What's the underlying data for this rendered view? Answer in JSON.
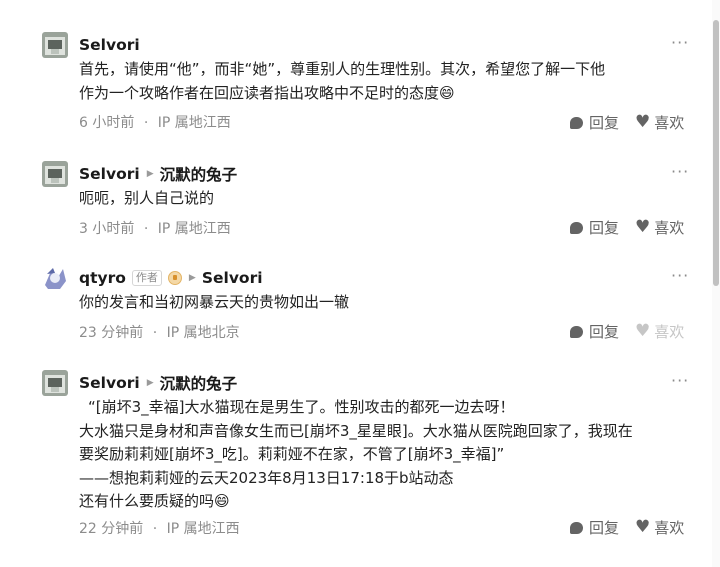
{
  "comments": [
    {
      "user": "Selvori",
      "reply_to": "",
      "lines": [
        "首先，请使用“他”，而非“她”，尊重别人的生理性别。其次，希望您了解一下他",
        "作为一个攻略作者在回应读者指出攻略中不足时的态度😄"
      ],
      "time": "6 小时前",
      "location": "IP 属地江西",
      "reply_label": "回复",
      "like_label": "喜欢"
    },
    {
      "user": "Selvori",
      "reply_to": "沉默的兔子",
      "lines": [
        "呃呃，别人自己说的"
      ],
      "time": "3 小时前",
      "location": "IP 属地江西",
      "reply_label": "回复",
      "like_label": "喜欢"
    },
    {
      "user": "qtyro",
      "author_badge": "作者",
      "reply_to": "Selvori",
      "lines": [
        "你的发言和当初网暴云天的贵物如出一辙"
      ],
      "time": "23 分钟前",
      "location": "IP 属地北京",
      "reply_label": "回复",
      "like_label": "喜欢"
    },
    {
      "user": "Selvori",
      "reply_to": "沉默的兔子",
      "lines": [
        "“[崩坏3_幸福]大水猫现在是男生了。性别攻击的都死一边去呀！",
        "大水猫只是身材和声音像女生而已[崩坏3_星星眼]。大水猫从医院跑回家了，我现在",
        "要奖励莉莉娅[崩坏3_吃]。莉莉娅不在家，不管了[崩坏3_幸福]”",
        "——想抱莉莉娅的云天2023年8月13日17:18于b站动态",
        "还有什么要质疑的吗😄"
      ],
      "time": "22 分钟前",
      "location": "IP 属地江西",
      "reply_label": "回复",
      "like_label": "喜欢"
    }
  ],
  "meta_separator": "·",
  "more_icon": "more-dots-icon",
  "colors": {
    "text": "#1a1a1a",
    "meta": "#8c8c8c",
    "action": "#646464",
    "disabled": "#c6c6c6"
  }
}
